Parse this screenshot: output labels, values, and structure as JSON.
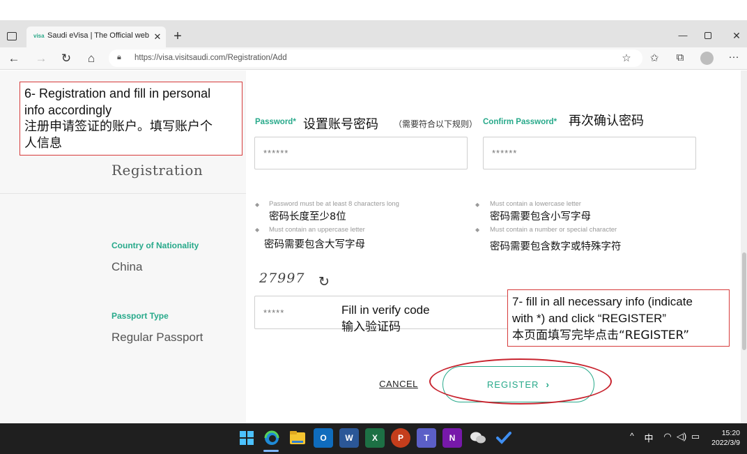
{
  "browser": {
    "tab_title": "Saudi eVisa | The Official website",
    "tab_favicon": "visa-logo-icon",
    "tab_close": "✕",
    "new_tab": "+",
    "url": "https://visa.visitsaudi.com/Registration/Add",
    "window_controls": {
      "minimize": "—",
      "close": "✕"
    }
  },
  "sidebar": {
    "title": "Registration",
    "country_label": "Country of Nationality",
    "country_value": "China",
    "passport_label": "Passport Type",
    "passport_value": "Regular Passport"
  },
  "form": {
    "password_label": "Password*",
    "password_placeholder": "******",
    "confirm_label": "Confirm Password*",
    "confirm_placeholder": "******",
    "rules": [
      {
        "en": "Password must be at least 8 characters long",
        "cn": "密码长度至少8位"
      },
      {
        "en": "Must contain an uppercase letter",
        "cn": "密码需要包含大写字母"
      },
      {
        "en": "Must contain a lowercase letter",
        "cn": "密码需要包含小写字母"
      },
      {
        "en": "Must contain a number or special character",
        "cn": "密码需要包含数字或特殊字符"
      }
    ],
    "captcha_text": "27997",
    "captcha_placeholder": "*****",
    "cancel_label": "CANCEL",
    "register_label": "REGISTER",
    "register_chevron": "›"
  },
  "annotations": {
    "step6_line1": "6- Registration and fill in personal",
    "step6_line2": "info accordingly",
    "step6_line3": "注册申请签证的账户。填写账户个",
    "step6_line4": "人信息",
    "password_cn": "设置账号密码",
    "password_cn_note": "（需要符合以下规则）",
    "confirm_cn": "再次确认密码",
    "verify_line1": "Fill in verify code",
    "verify_line2": "输入验证码",
    "step7_line1": "7- fill in all necessary info (indicate",
    "step7_line2": "with *) and click “REGISTER”",
    "step7_line3": "本页面填写完毕点击“REGISTER”",
    "highlight_color": "#c8242f"
  },
  "taskbar": {
    "apps": [
      "start-icon",
      "edge-icon",
      "file-explorer-icon",
      "outlook-icon",
      "word-icon",
      "excel-icon",
      "powerpoint-icon",
      "teams-icon",
      "onenote-icon",
      "wechat-icon",
      "todo-icon"
    ],
    "ime": "中",
    "time": "15:20",
    "date": "2022/3/9"
  },
  "colors": {
    "accent": "#27a98a",
    "annotation_border": "#d63a3a",
    "taskbar": "#1f1f1f"
  }
}
